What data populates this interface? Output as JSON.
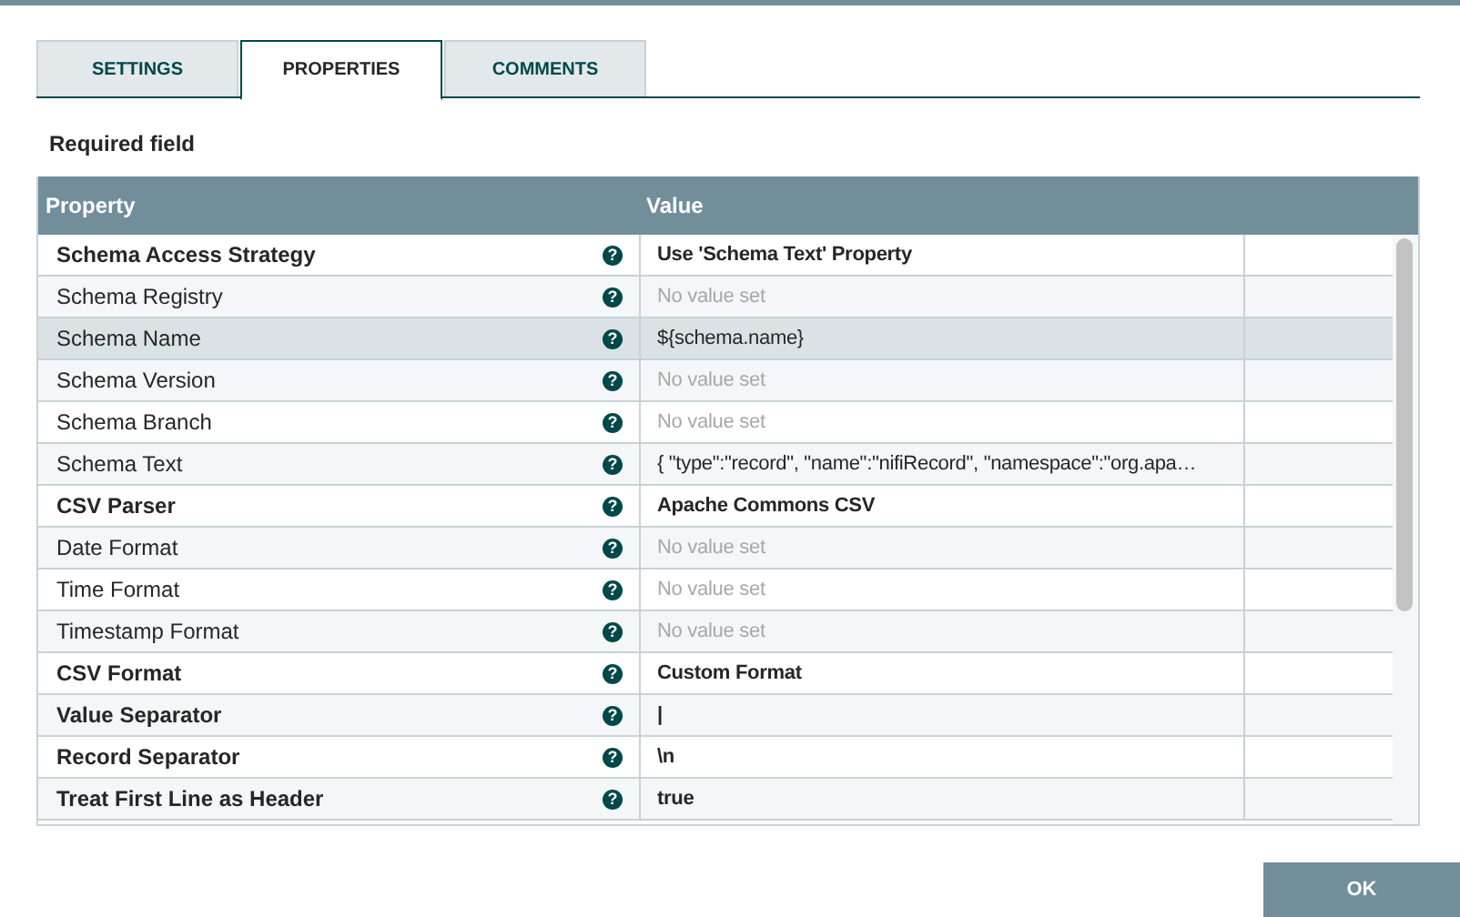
{
  "tabs": [
    {
      "label": "SETTINGS",
      "selected": false
    },
    {
      "label": "PROPERTIES",
      "selected": true
    },
    {
      "label": "COMMENTS",
      "selected": false
    }
  ],
  "required_note": "Required field",
  "table": {
    "columns": [
      "Property",
      "Value"
    ],
    "rows": [
      {
        "property": "Schema Access Strategy",
        "required": true,
        "value": "Use 'Schema Text' Property",
        "value_set": true,
        "selected": false,
        "help": "?"
      },
      {
        "property": "Schema Registry",
        "required": false,
        "value": "No value set",
        "value_set": false,
        "selected": false,
        "help": "?"
      },
      {
        "property": "Schema Name",
        "required": false,
        "value": "${schema.name}",
        "value_set": true,
        "selected": true,
        "help": "?"
      },
      {
        "property": "Schema Version",
        "required": false,
        "value": "No value set",
        "value_set": false,
        "selected": false,
        "help": "?"
      },
      {
        "property": "Schema Branch",
        "required": false,
        "value": "No value set",
        "value_set": false,
        "selected": false,
        "help": "?"
      },
      {
        "property": "Schema Text",
        "required": false,
        "value": "{ \"type\":\"record\", \"name\":\"nifiRecord\", \"namespace\":\"org.apa…",
        "value_set": true,
        "selected": false,
        "help": "?"
      },
      {
        "property": "CSV Parser",
        "required": true,
        "value": "Apache Commons CSV",
        "value_set": true,
        "selected": false,
        "help": "?"
      },
      {
        "property": "Date Format",
        "required": false,
        "value": "No value set",
        "value_set": false,
        "selected": false,
        "help": "?"
      },
      {
        "property": "Time Format",
        "required": false,
        "value": "No value set",
        "value_set": false,
        "selected": false,
        "help": "?"
      },
      {
        "property": "Timestamp Format",
        "required": false,
        "value": "No value set",
        "value_set": false,
        "selected": false,
        "help": "?"
      },
      {
        "property": "CSV Format",
        "required": true,
        "value": "Custom Format",
        "value_set": true,
        "selected": false,
        "help": "?"
      },
      {
        "property": "Value Separator",
        "required": true,
        "value": "|",
        "value_set": true,
        "selected": false,
        "help": "?"
      },
      {
        "property": "Record Separator",
        "required": true,
        "value": "\\n",
        "value_set": true,
        "selected": false,
        "help": "?"
      },
      {
        "property": "Treat First Line as Header",
        "required": true,
        "value": "true",
        "value_set": true,
        "selected": false,
        "help": "?"
      }
    ]
  },
  "ok_button": "OK"
}
